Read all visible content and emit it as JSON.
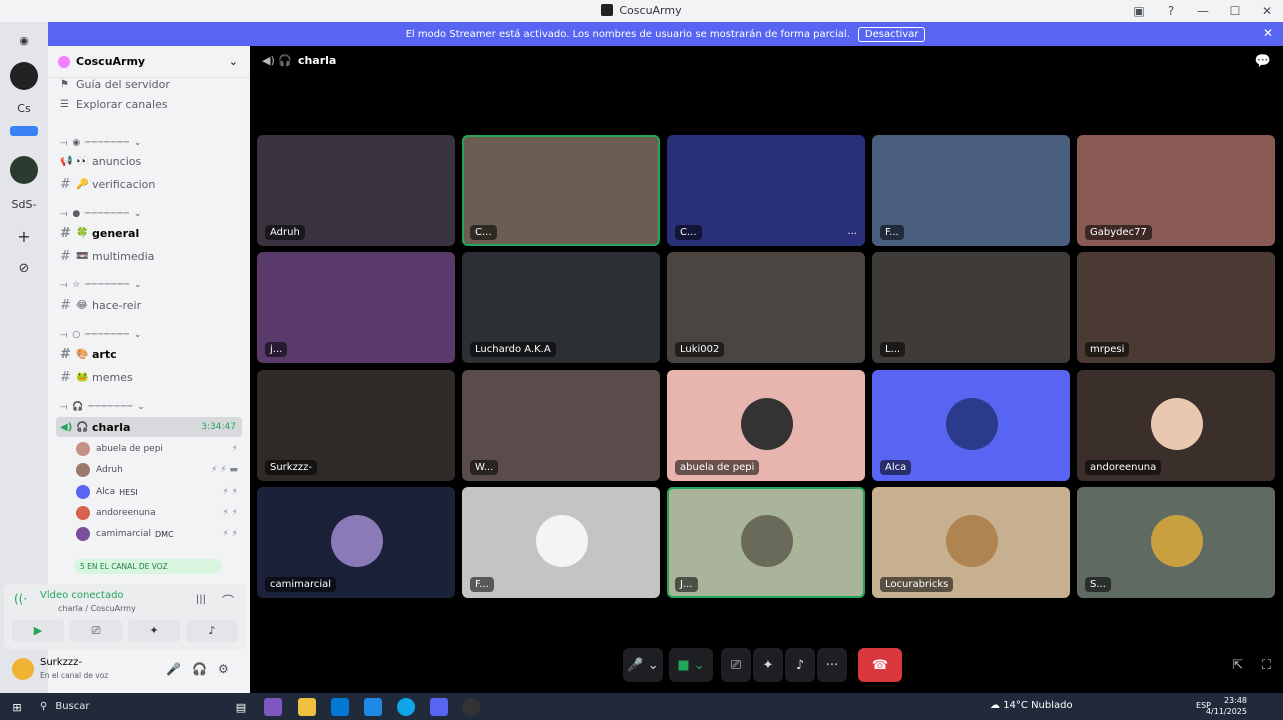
{
  "window": {
    "title": "CoscuArmy"
  },
  "banner": {
    "text": "El modo Streamer está activado. Los nombres de usuario se mostrarán de forma parcial.",
    "button": "Desactivar"
  },
  "rail": {
    "items": [
      "Cs",
      "SdS-"
    ]
  },
  "server": {
    "name": "CoscuArmy"
  },
  "channels": {
    "guide": "Guía del servidor",
    "browse": "Explorar canales",
    "anuncios": "anuncios",
    "verificacion": "verificacion",
    "general": "general",
    "multimedia": "multimedia",
    "hace_reir": "hace-reir",
    "arte": "artc",
    "memes": "memes",
    "charla": "charla",
    "charla_time": "3:34:47"
  },
  "voice_members": [
    {
      "name": "abuela de pepi",
      "tag": ""
    },
    {
      "name": "Adruh",
      "tag": ""
    },
    {
      "name": "Alca",
      "tag": "HESI"
    },
    {
      "name": "andoreenuna",
      "tag": ""
    },
    {
      "name": "camimarcial",
      "tag": "DMC"
    }
  ],
  "voice_pill": "5 EN EL CANAL DE VOZ",
  "voice_panel": {
    "status": "Vídeo conectado",
    "sub": "charla / CoscuArmy"
  },
  "user": {
    "name": "Surkzzz-",
    "status": "En el canal de voz"
  },
  "stage": {
    "channel": "charla"
  },
  "tiles": [
    {
      "label": "Adruh",
      "color": "#3a3340"
    },
    {
      "label": "C...",
      "color": "#6b5d52"
    },
    {
      "label": "C...",
      "color": "#2a2f7a"
    },
    {
      "label": "F...",
      "color": "#4a5f7e"
    },
    {
      "label": "Gabydec77",
      "color": "#8a5a55"
    },
    {
      "label": "j...",
      "color": "#5a3a6a"
    },
    {
      "label": "Luchardo A.K.A",
      "color": "#2c2f33"
    },
    {
      "label": "Luki002",
      "color": "#4b4541"
    },
    {
      "label": "L...",
      "color": "#3e3b38"
    },
    {
      "label": "mrpesi",
      "color": "#4a3a33"
    },
    {
      "label": "Surkzzz-",
      "color": "#2e2a28"
    },
    {
      "label": "W...",
      "color": "#5a4c4a"
    },
    {
      "label": "abuela de pepi",
      "color": "#e8b4ae"
    },
    {
      "label": "Alca",
      "color": "#5865f2"
    },
    {
      "label": "andoreenuna",
      "color": "#3b2f2c"
    },
    {
      "label": "camimarcial",
      "color": "#1b2138"
    },
    {
      "label": "F...",
      "color": "#c4c4c4"
    },
    {
      "label": "J...",
      "color": "#a9b49a"
    },
    {
      "label": "Locurabricks",
      "color": "#c6b08f"
    },
    {
      "label": "S...",
      "color": "#5f6b62"
    }
  ],
  "taskbar": {
    "search": "Buscar",
    "weather": "14°C  Nublado",
    "lang": "ESP",
    "time": "23:48",
    "date": "4/11/2025"
  }
}
